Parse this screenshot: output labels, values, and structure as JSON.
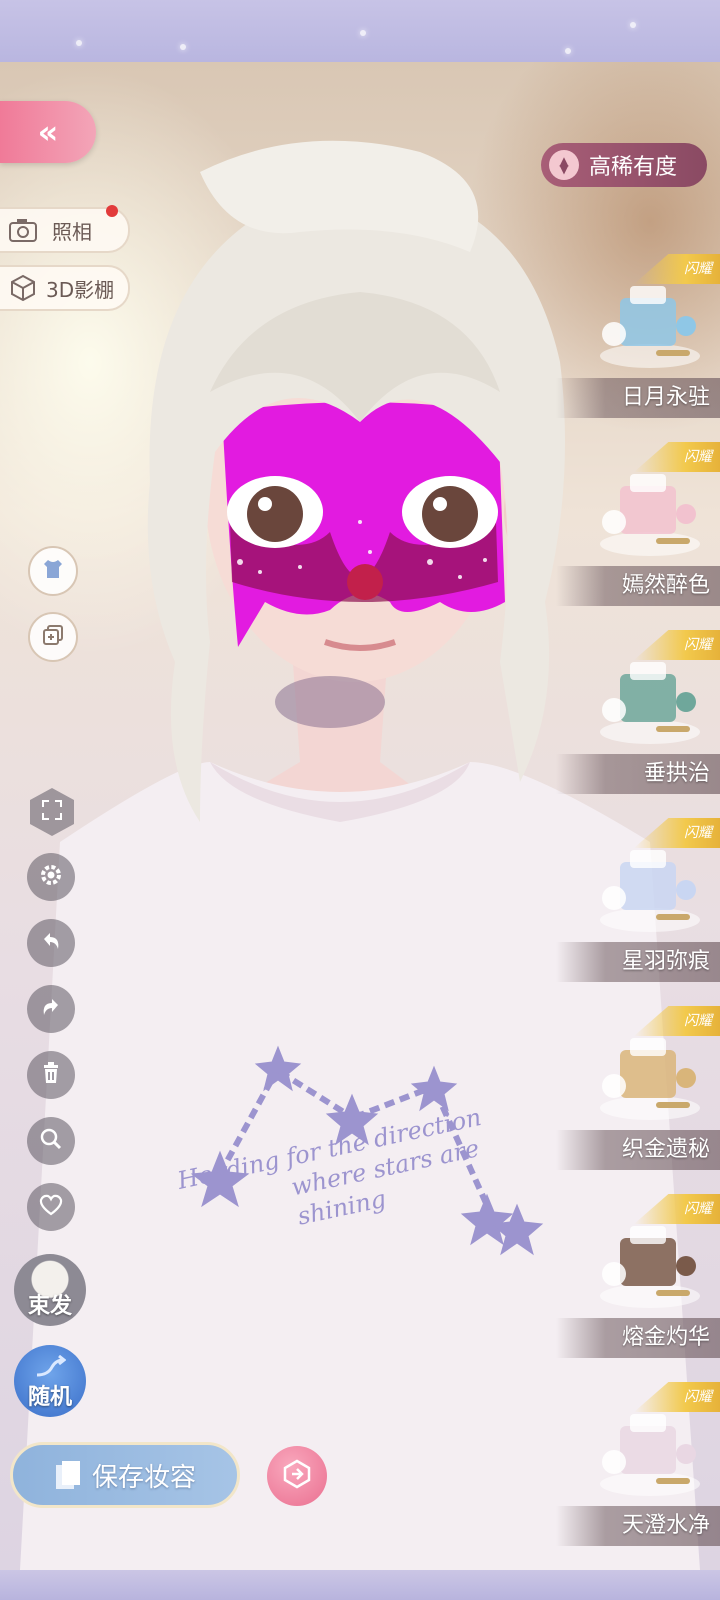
{
  "top_bar": {},
  "left_panel": {
    "back_icon": "double-chevron-left-icon",
    "photo_label": "照相",
    "studio_label": "3D影棚",
    "hairstyle_label": "束发",
    "random_label": "随机",
    "save_label": "保存妆容"
  },
  "right_panel": {
    "sort_label": "高稀有度",
    "badge_text": "闪耀",
    "items": [
      {
        "name": "日月永驻",
        "accent": "#8fc7e6"
      },
      {
        "name": "嫣然醉色",
        "accent": "#f2c2cf"
      },
      {
        "name": "垂拱治",
        "accent": "#6fa79b"
      },
      {
        "name": "星羽弥痕",
        "accent": "#c9d6f2"
      },
      {
        "name": "织金遗秘",
        "accent": "#d9b57a"
      },
      {
        "name": "熔金灼华",
        "accent": "#7a5a4a"
      },
      {
        "name": "天澄水净",
        "accent": "#e9d7e3"
      }
    ]
  },
  "shirt": {
    "line1": "Heading for the direction",
    "line2": "where stars are shining"
  },
  "colors": {
    "accent_pink": "#f07a98",
    "save_blue": "#8fb3dc",
    "rarity_badge": "#f2c94c",
    "makeup_magenta": "#e21be0"
  }
}
